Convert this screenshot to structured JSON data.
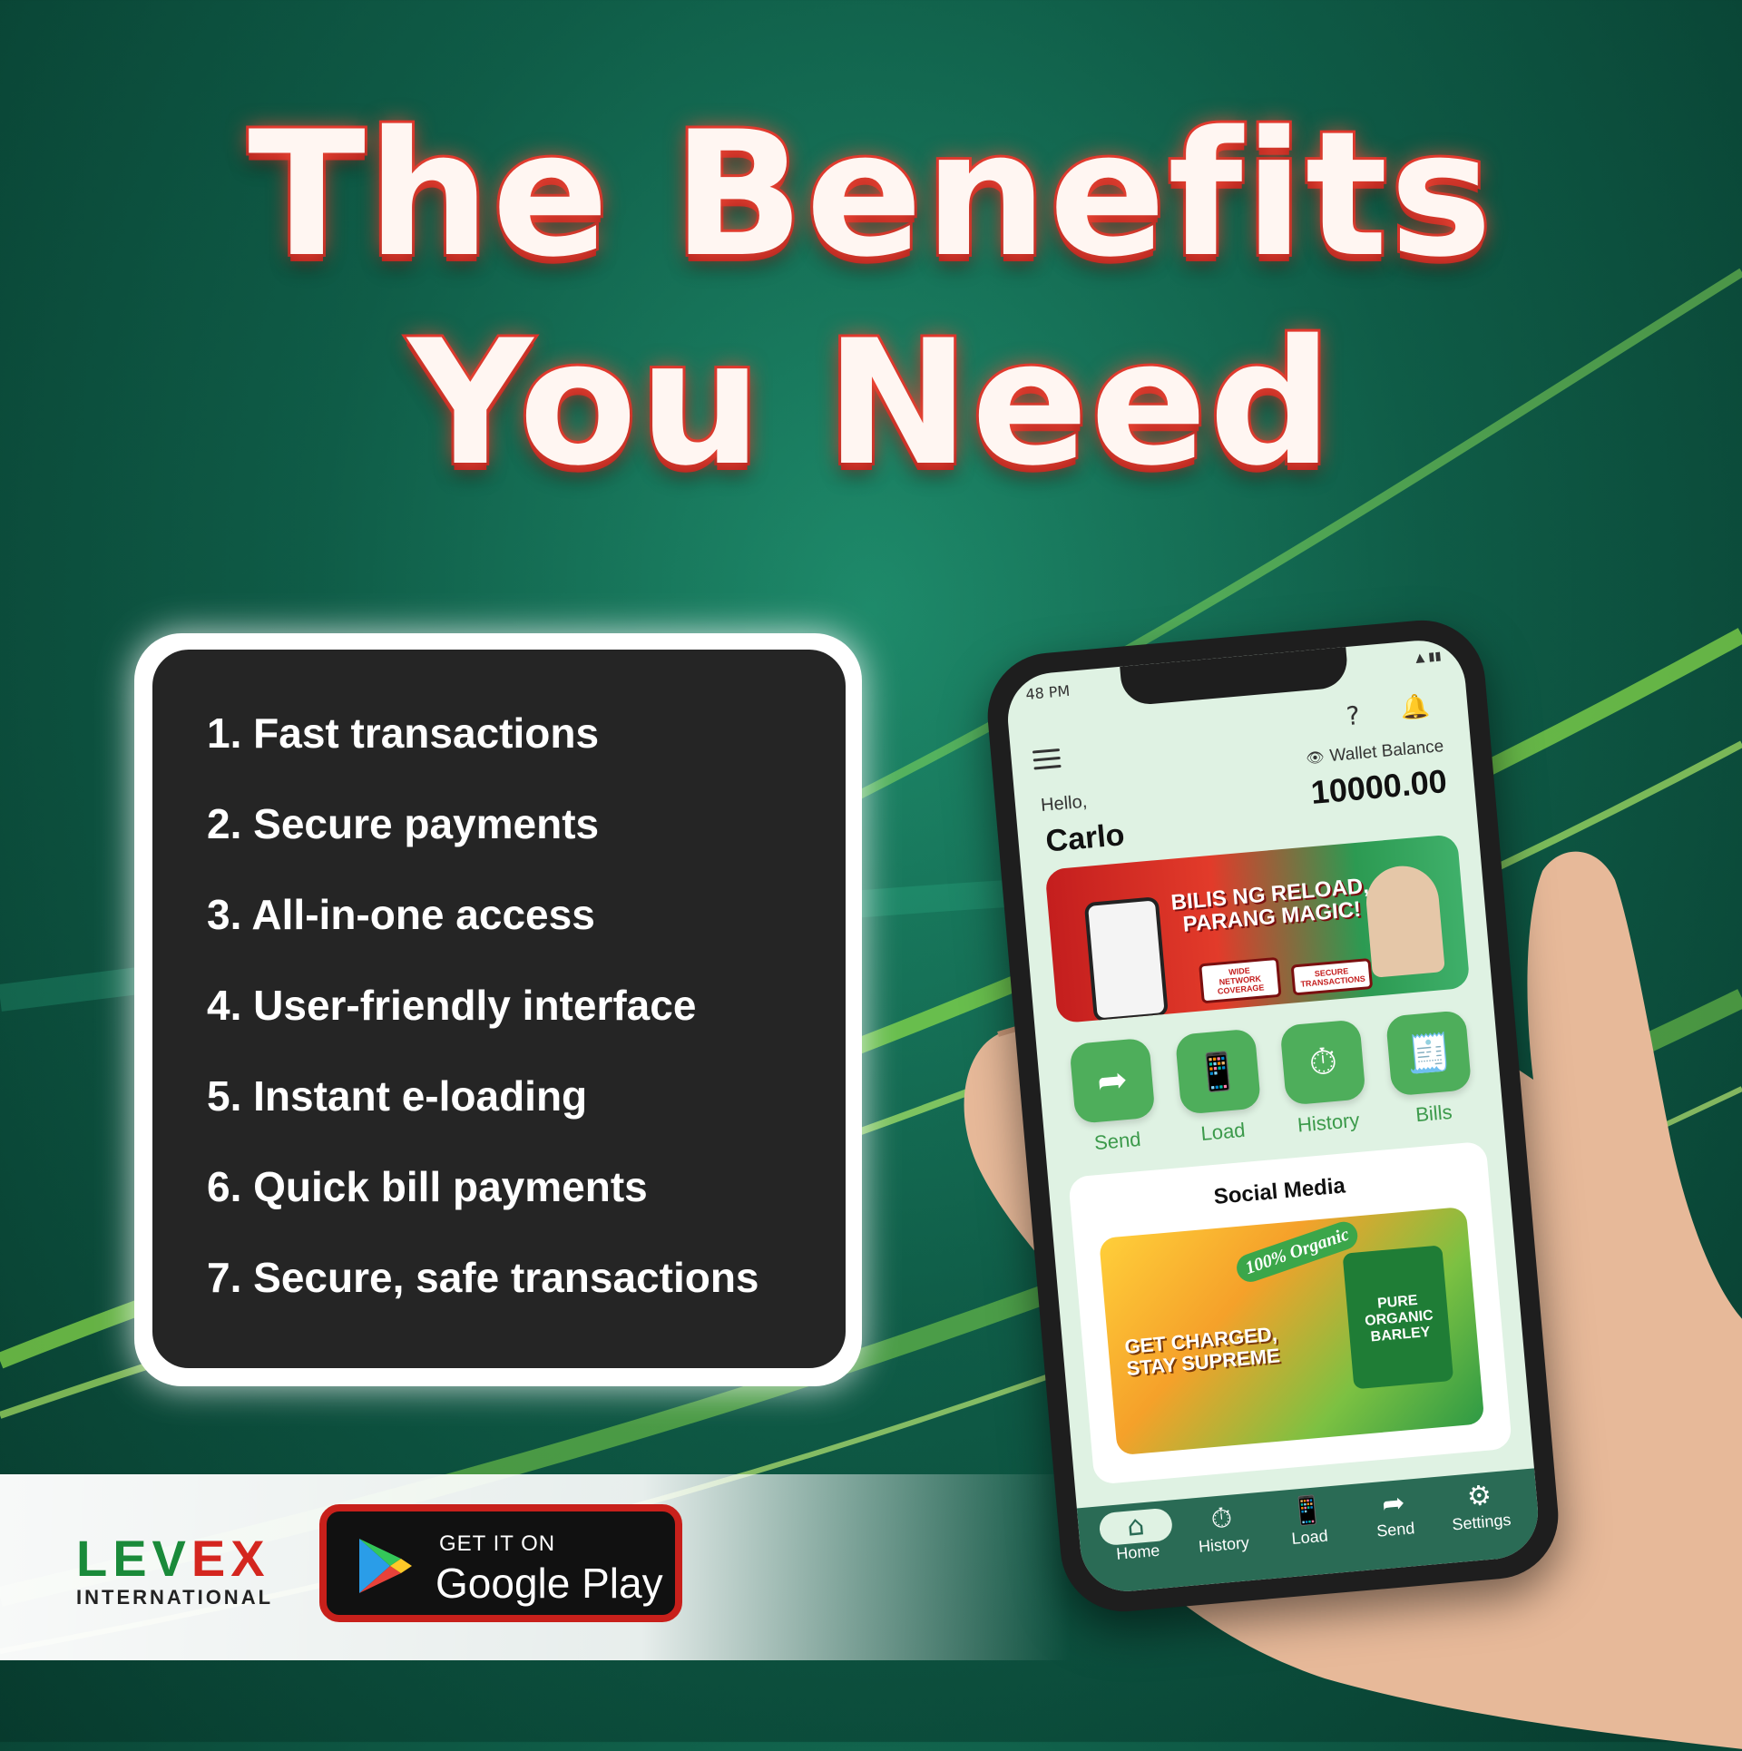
{
  "headline": {
    "line1": "The Benefits",
    "line2": "You Need"
  },
  "benefits": [
    "1. Fast transactions",
    "2. Secure payments",
    "3. All-in-one access",
    "4. User-friendly interface",
    "5. Instant e-loading",
    "6. Quick bill payments",
    "7. Secure, safe transactions"
  ],
  "brand": {
    "logo_prefix": "LEV",
    "logo_suffix": "EX",
    "logo_sub": "INTERNATIONAL"
  },
  "store_button": {
    "small": "GET IT ON",
    "big": "Google Play"
  },
  "phone": {
    "status_time": "48 PM",
    "help": "?",
    "greeting": "Hello,",
    "user_name": "Carlo",
    "wallet_label": "Wallet Balance",
    "wallet_amount": "10000.00",
    "promo": {
      "headline_1": "BILIS NG RELOAD,",
      "headline_2": "PARANG MAGIC!",
      "tag_1": "WIDE NETWORK COVERAGE",
      "tag_2": "SECURE TRANSACTIONS"
    },
    "quick_actions": [
      "Send",
      "Load",
      "History",
      "Bills"
    ],
    "social": {
      "title": "Social Media",
      "ad_badge": "100% Organic",
      "ad_line_1": "GET CHARGED,",
      "ad_line_2": "STAY SUPREME",
      "ad_product": "PURE ORGANIC BARLEY"
    },
    "bottom_nav": [
      "Home",
      "History",
      "Load",
      "Send",
      "Settings"
    ],
    "active_tab": "Home"
  },
  "colors": {
    "background": "#0f5c47",
    "headline_stroke": "#d8322a",
    "card": "#252525",
    "app_green": "#4eae5b",
    "nav_bar": "#2a6b55",
    "store_border": "#c8201b"
  },
  "icons": [
    "play-store-icon",
    "menu-icon",
    "help-icon",
    "bell-icon",
    "eye-icon",
    "send-icon",
    "load-icon",
    "history-icon",
    "bills-icon",
    "home-icon",
    "settings-icon"
  ]
}
